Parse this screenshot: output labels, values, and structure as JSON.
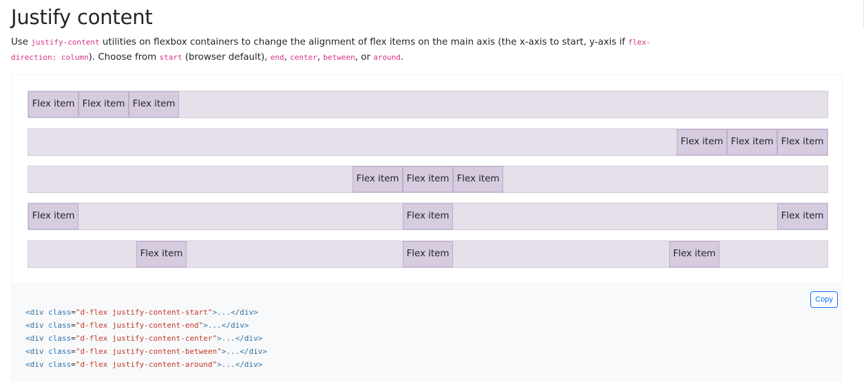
{
  "heading": "Justify content",
  "lead": {
    "t1": "Use ",
    "code1": "justify-content",
    "t2": " utilities on flexbox containers to change the alignment of flex items on the main axis (the x-axis to start, y-axis if ",
    "code2": "flex-direction: column",
    "t3": "). Choose from ",
    "code3": "start",
    "t4": " (browser default), ",
    "code4": "end",
    "t5": ", ",
    "code5": "center",
    "t6": ", ",
    "code6": "between",
    "t7": ", or ",
    "code7": "around",
    "t8": "."
  },
  "item_label": "Flex item",
  "rows": [
    {
      "mode": "start"
    },
    {
      "mode": "end"
    },
    {
      "mode": "center"
    },
    {
      "mode": "between"
    },
    {
      "mode": "around"
    }
  ],
  "copy_label": "Copy",
  "code_lines": [
    {
      "open": "<div",
      "attr": "class",
      "eq": "=",
      "value": "\"d-flex justify-content-start\"",
      "rest": ">...",
      "close": "</div>"
    },
    {
      "open": "<div",
      "attr": "class",
      "eq": "=",
      "value": "\"d-flex justify-content-end\"",
      "rest": ">...",
      "close": "</div>"
    },
    {
      "open": "<div",
      "attr": "class",
      "eq": "=",
      "value": "\"d-flex justify-content-center\"",
      "rest": ">...",
      "close": "</div>"
    },
    {
      "open": "<div",
      "attr": "class",
      "eq": "=",
      "value": "\"d-flex justify-content-between\"",
      "rest": ">...",
      "close": "</div>"
    },
    {
      "open": "<div",
      "attr": "class",
      "eq": "=",
      "value": "\"d-flex justify-content-around\"",
      "rest": ">...",
      "close": "</div>"
    }
  ],
  "colors": {
    "row_bg": "#e5e0ea",
    "item_bg": "#d6cbdf",
    "code_pink": "#d63384",
    "copy_blue": "#0d6efd"
  }
}
